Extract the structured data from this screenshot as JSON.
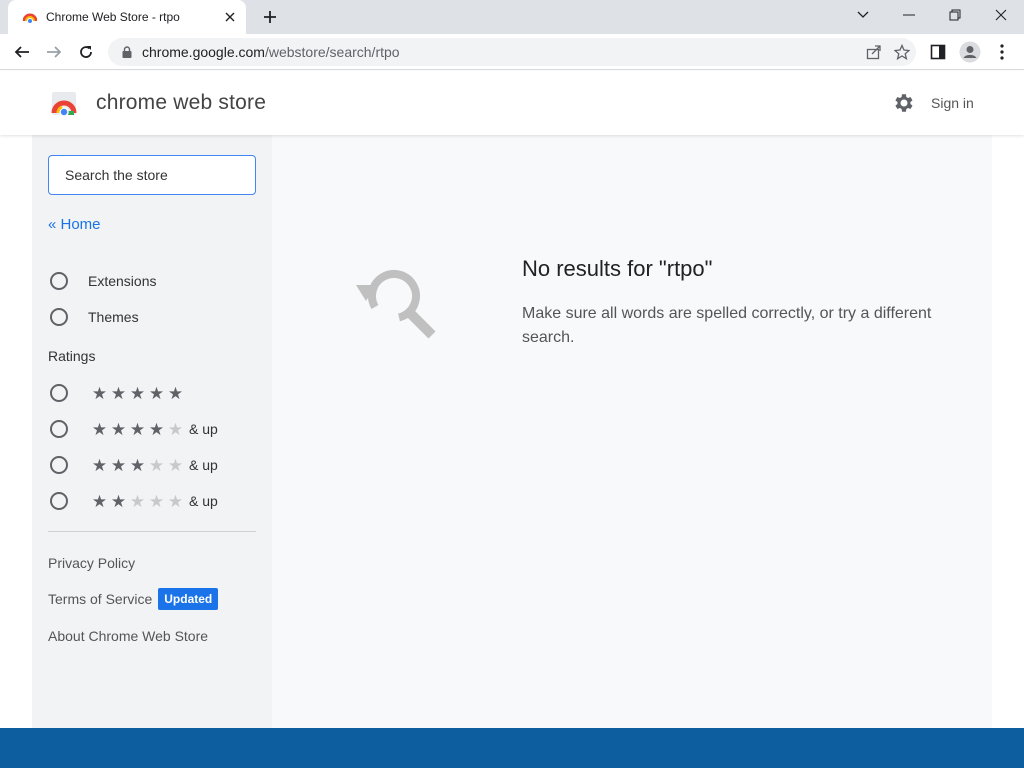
{
  "browser": {
    "tab_title": "Chrome Web Store - rtpo",
    "url_host": "chrome.google.com",
    "url_path": "/webstore/search/rtpo"
  },
  "store": {
    "title": "chrome web store",
    "signin_label": "Sign in"
  },
  "sidebar": {
    "search_placeholder": "Search the store",
    "home_link": "« Home",
    "categories": [
      {
        "label": "Extensions"
      },
      {
        "label": "Themes"
      }
    ],
    "ratings_heading": "Ratings",
    "ratings": [
      {
        "stars": 5,
        "suffix": ""
      },
      {
        "stars": 4,
        "suffix": "& up"
      },
      {
        "stars": 3,
        "suffix": "& up"
      },
      {
        "stars": 2,
        "suffix": "& up"
      }
    ],
    "footer": {
      "privacy": "Privacy Policy",
      "terms": "Terms of Service",
      "terms_badge": "Updated",
      "about": "About Chrome Web Store"
    }
  },
  "main": {
    "no_results_title": "No results for \"rtpo\"",
    "no_results_text": "Make sure all words are spelled correctly, or try a different search."
  },
  "colors": {
    "accent": "#1a73e8",
    "taskbar": "#0c5e9e"
  },
  "icons": [
    "chrome-webstore-favicon",
    "close-icon",
    "plus-icon",
    "chevron-down-icon",
    "minimize-icon",
    "restore-icon",
    "window-close-icon",
    "back-arrow-icon",
    "forward-arrow-icon",
    "reload-icon",
    "lock-icon",
    "share-icon",
    "star-bookmark-icon",
    "side-panel-icon",
    "profile-icon",
    "kebab-menu-icon",
    "gear-icon",
    "search-no-results-icon"
  ]
}
